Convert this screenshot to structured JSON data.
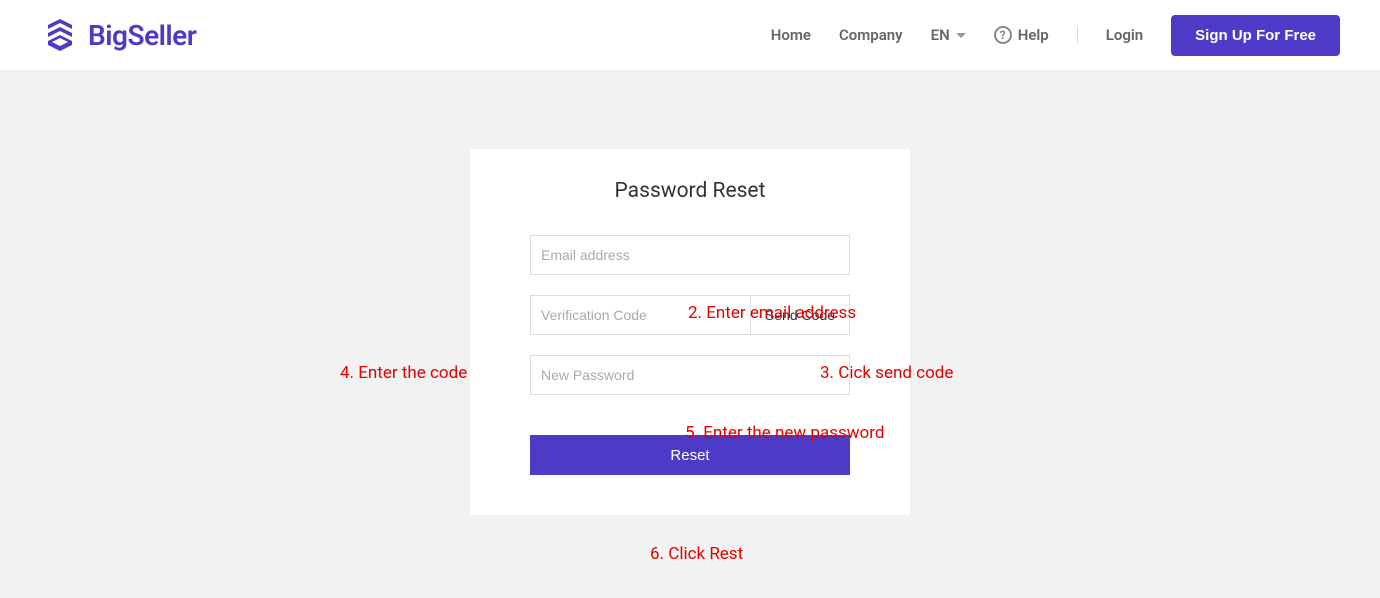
{
  "header": {
    "logo_text": "BigSeller",
    "nav": {
      "home": "Home",
      "company": "Company",
      "lang": "EN",
      "help": "Help",
      "login": "Login",
      "signup": "Sign Up For Free"
    }
  },
  "card": {
    "title": "Password Reset",
    "email_placeholder": "Email address",
    "code_placeholder": "Verification Code",
    "send_code_label": "Send Code",
    "password_placeholder": "New Password",
    "reset_label": "Reset"
  },
  "annotations": {
    "a2": "2. Enter email address",
    "a3": "3. Cick send code",
    "a4": "4. Enter the code",
    "a5": "5. Enter the new password",
    "a6": "6. Click Rest"
  }
}
